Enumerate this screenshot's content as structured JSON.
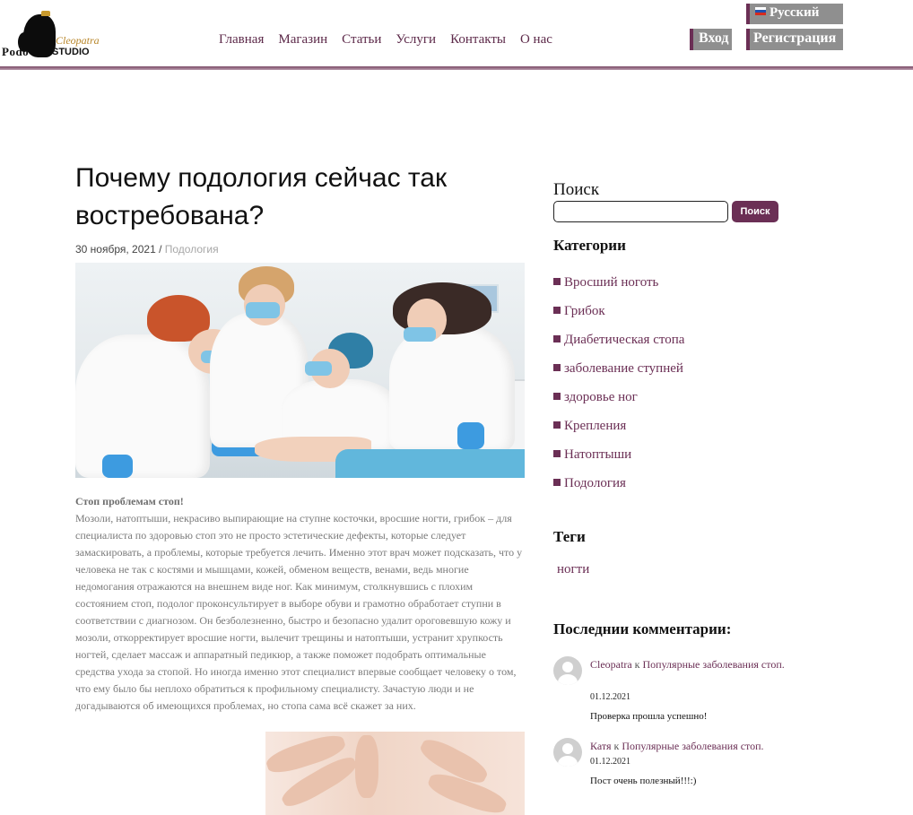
{
  "header": {
    "logo": {
      "name": "Podo",
      "brand_script": "Cleopatra",
      "studio": "STUDIO"
    },
    "nav": [
      "Главная",
      "Магазин",
      "Статьи",
      "Услуги",
      "Контакты",
      "О нас"
    ],
    "language": "Русский",
    "login": "Вход",
    "register": "Регистрация"
  },
  "article": {
    "title": "Почему подология сейчас так востребована?",
    "date": "30 ноября, 2021 /",
    "category": "Подология",
    "lead": "Стоп проблемам стоп!",
    "body": "Мозоли, натоптыши, некрасиво выпирающие на ступне косточки, вросшие ногти, грибок – для специалиста по здоровью стоп это не просто эстетические дефекты, которые следует замаскировать, а проблемы, которые требуется лечить. Именно этот врач может подсказать, что у человека не так с костями и мышцами, кожей, обменом веществ, венами, ведь многие недомогания отражаются на внешнем виде ног. Как минимум, столкнувшись с плохим состоянием стоп, подолог проконсультирует в выборе обуви и грамотно обработает ступни в соответствии с диагнозом. Он безболезненно, быстро и безопасно удалит ороговевшую кожу и мозоли, откорректирует вросшие ногти, вылечит трещины и натоптыши, устранит хрупкость ногтей, сделает массаж и аппаратный педикюр, а также поможет подобрать оптимальные средства ухода за стопой. Но иногда именно этот специалист впервые сообщает человеку о том, что ему было бы неплохо обратиться к профильному специалисту. Зачастую люди и не догадываются об имеющихся проблемах, но стопа сама всё скажет за них."
  },
  "sidebar": {
    "search": {
      "title": "Поиск",
      "value": "",
      "button": "Поиск"
    },
    "categories_title": "Категории",
    "categories": [
      "Вросший ноготь",
      "Грибок",
      "Диабетическая стопа",
      "заболевание ступней",
      "здоровье ног",
      "Крепления",
      "Натоптыши",
      "Подология"
    ],
    "tags_title": "Теги",
    "tags": [
      "ногти"
    ],
    "comments_title": "Последнии комментарии:",
    "comments": [
      {
        "author": "Cleopatra",
        "connector": "к",
        "post": "Популярные заболевания стоп.",
        "date": "01.12.2021",
        "text": "Проверка прошла успешно!"
      },
      {
        "author": "Катя",
        "connector": "к",
        "post": "Популярные заболевания стоп.",
        "date": "01.12.2021",
        "text": "Пост очень полезный!!!:)"
      }
    ]
  },
  "colors": {
    "accent": "#6b2f55",
    "button_gray": "#8f8f8f",
    "muted_text": "#7a7a7a"
  }
}
